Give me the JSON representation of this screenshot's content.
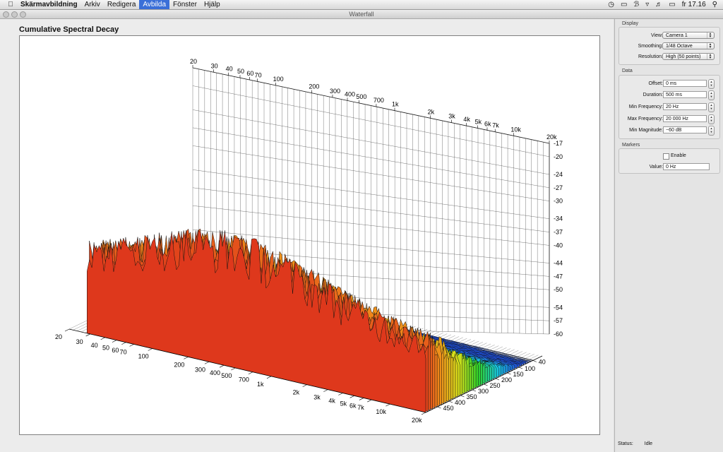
{
  "menubar": {
    "items": [
      "Skärmavbildning",
      "Arkiv",
      "Redigera",
      "Avbilda",
      "Fönster",
      "Hjälp"
    ],
    "active": "Avbilda",
    "clock": "fr 17.16"
  },
  "window": {
    "title": "Waterfall"
  },
  "chart_title": "Cumulative Spectral Decay",
  "panel": {
    "display": {
      "title": "Display",
      "view_label": "View:",
      "view_value": "Camera 1",
      "smoothing_label": "Smoothing:",
      "smoothing_value": "1/48 Octave",
      "resolution_label": "Resolution:",
      "resolution_value": "High (50 points)"
    },
    "data": {
      "title": "Data",
      "offset_label": "Offset:",
      "offset_value": "0 ms",
      "duration_label": "Duration:",
      "duration_value": "500 ms",
      "min_freq_label": "Min Frequency:",
      "min_freq_value": "20 Hz",
      "max_freq_label": "Max Frequency:",
      "max_freq_value": "20 000 Hz",
      "min_mag_label": "Min Magnitude:",
      "min_mag_value": "−60 dB"
    },
    "markers": {
      "title": "Markers",
      "enable_label": "Enable",
      "value_label": "Value:",
      "value_value": "0 Hz"
    }
  },
  "status": {
    "label": "Status:",
    "value": "Idle"
  },
  "chart_data": {
    "type": "waterfall",
    "title": "Cumulative Spectral Decay",
    "frequency_ticks": [
      "20",
      "30",
      "40",
      "50",
      "60",
      "70",
      "100",
      "200",
      "300",
      "400",
      "500",
      "700",
      "1k",
      "2k",
      "3k",
      "4k",
      "5k",
      "6k",
      "7k",
      "10k",
      "20k"
    ],
    "magnitude_ticks": [
      "-17",
      "-20",
      "-24",
      "-27",
      "-30",
      "-34",
      "-37",
      "-40",
      "-44",
      "-47",
      "-50",
      "-54",
      "-57",
      "-60"
    ],
    "time_ticks": [
      "40",
      "100",
      "150",
      "200",
      "250",
      "300",
      "350",
      "400",
      "450"
    ],
    "freq_range_hz": [
      20,
      20000
    ],
    "magnitude_range_db": [
      -60,
      -17
    ],
    "time_range_ms": [
      0,
      500
    ],
    "color_scale": [
      "#1f4fd8",
      "#18c8e0",
      "#2ed12a",
      "#d8e01a",
      "#f08a1a",
      "#d81c1c"
    ]
  }
}
